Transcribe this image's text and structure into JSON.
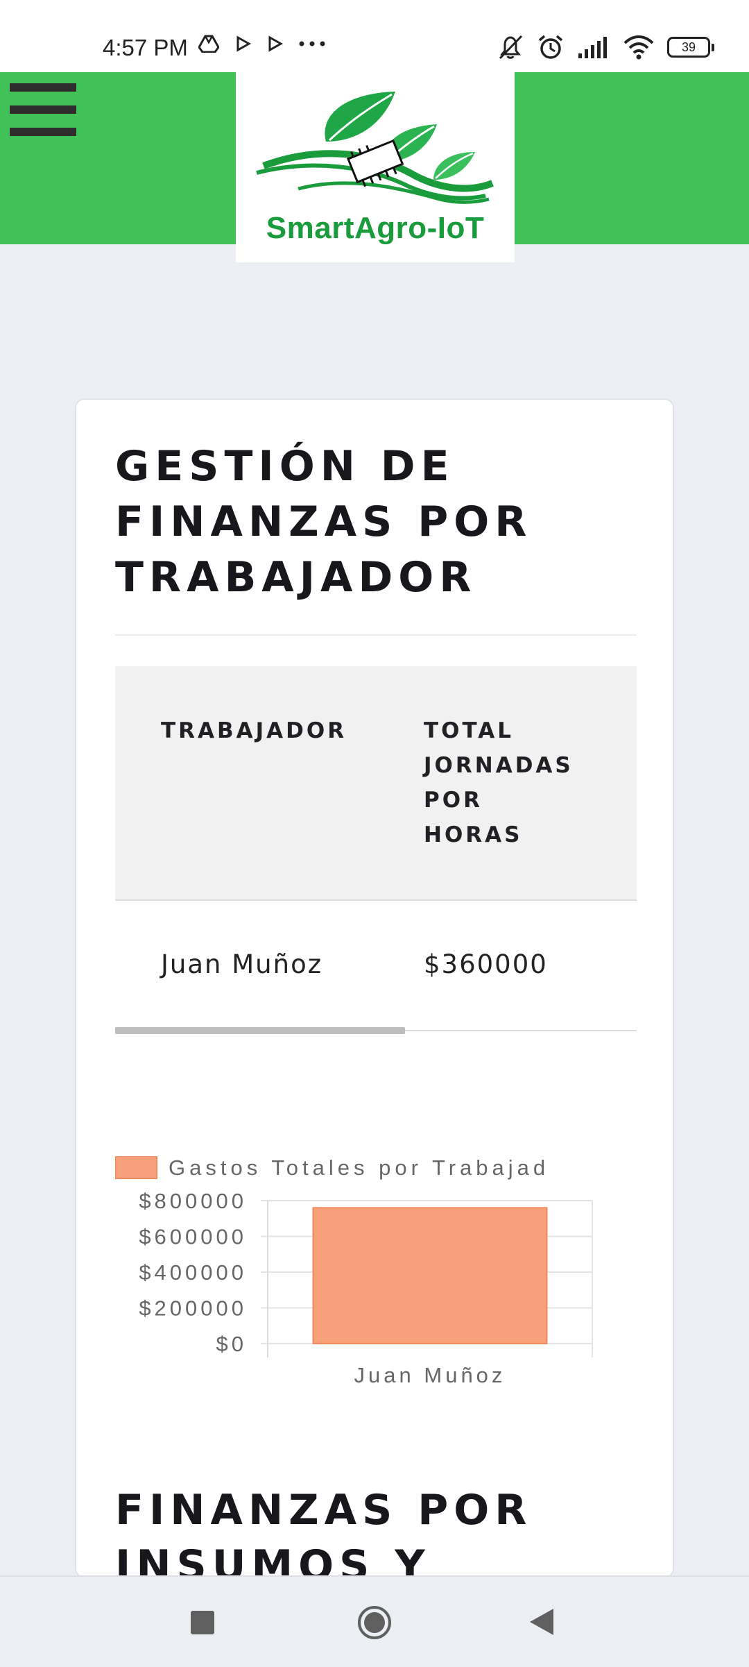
{
  "status_bar": {
    "time": "4:57 PM",
    "battery": "39",
    "icons": [
      "drive-icon",
      "play-icon",
      "play-icon",
      "more-dots-icon",
      "mute-icon",
      "alarm-icon",
      "signal-icon",
      "wifi-icon",
      "battery-icon"
    ]
  },
  "header": {
    "menu_icon": "hamburger-menu-icon",
    "logo_text": "SmartAgro-IoT",
    "colors": {
      "bar": "#40c256",
      "logo_text": "#1a9b3c"
    }
  },
  "section1": {
    "title": "GESTIÓN DE FINANZAS POR TRABAJADOR",
    "table": {
      "headers": [
        "TRABAJADOR",
        "TOTAL JORNADAS POR HORAS"
      ],
      "rows": [
        [
          "Juan Muñoz",
          "$360000"
        ]
      ]
    }
  },
  "chart_data": {
    "type": "bar",
    "legend": "Gastos Totales por Trabajad",
    "categories": [
      "Juan Muñoz"
    ],
    "series": [
      {
        "name": "Gastos Totales por Trabajad",
        "values": [
          760000
        ],
        "color": "#f7a07a"
      }
    ],
    "yticks": [
      "$800000",
      "$600000",
      "$400000",
      "$200000",
      "$0"
    ],
    "ylim": [
      0,
      800000
    ],
    "grid": true
  },
  "section2": {
    "title": "FINANZAS POR INSUMOS Y"
  },
  "nav_bar": {
    "icons": [
      "recents-square-icon",
      "home-circle-icon",
      "back-triangle-icon"
    ]
  }
}
